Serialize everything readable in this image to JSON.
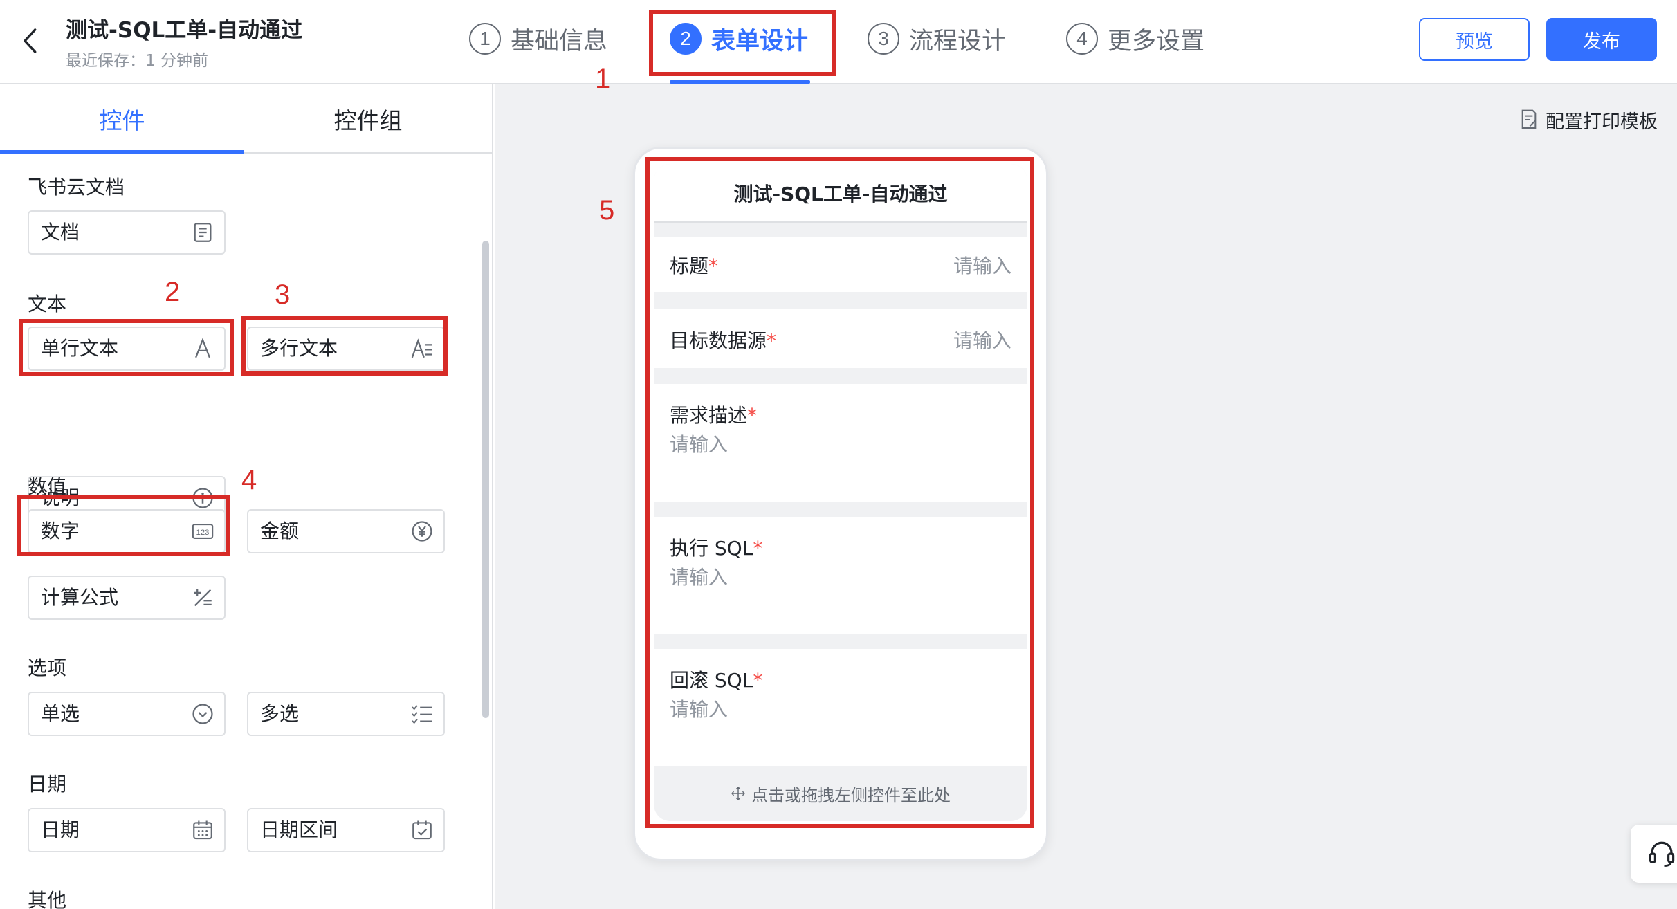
{
  "header": {
    "title": "测试-SQL工单-自动通过",
    "saved": "最近保存：1 分钟前",
    "steps": [
      {
        "num": "1",
        "label": "基础信息"
      },
      {
        "num": "2",
        "label": "表单设计"
      },
      {
        "num": "3",
        "label": "流程设计"
      },
      {
        "num": "4",
        "label": "更多设置"
      }
    ],
    "preview_label": "预览",
    "publish_label": "发布"
  },
  "panel": {
    "tabs": [
      "控件",
      "控件组"
    ],
    "sections": [
      {
        "title": "飞书云文档",
        "controls": [
          {
            "label": "文档",
            "icon": "document-icon"
          }
        ]
      },
      {
        "title": "文本",
        "controls": [
          {
            "label": "单行文本",
            "icon": "single-line-text-icon"
          },
          {
            "label": "多行文本",
            "icon": "multi-line-text-icon"
          },
          {
            "label": "说明",
            "icon": "info-icon"
          }
        ]
      },
      {
        "title": "数值",
        "controls": [
          {
            "label": "数字",
            "icon": "number-123-icon"
          },
          {
            "label": "金额",
            "icon": "yen-coin-icon"
          },
          {
            "label": "计算公式",
            "icon": "formula-icon"
          }
        ]
      },
      {
        "title": "选项",
        "controls": [
          {
            "label": "单选",
            "icon": "chevron-circle-icon"
          },
          {
            "label": "多选",
            "icon": "checklist-icon"
          }
        ]
      },
      {
        "title": "日期",
        "controls": [
          {
            "label": "日期",
            "icon": "calendar-icon"
          },
          {
            "label": "日期区间",
            "icon": "calendar-check-icon"
          }
        ]
      },
      {
        "title": "其他",
        "controls": []
      }
    ]
  },
  "canvas": {
    "print_template": "配置打印模板",
    "form_title": "测试-SQL工单-自动通过",
    "fields": [
      {
        "label": "标题",
        "required": "*",
        "placeholder": "请输入"
      },
      {
        "label": "目标数据源",
        "required": "*",
        "placeholder": "请输入"
      },
      {
        "label": "需求描述",
        "required": "*",
        "placeholder": "请输入"
      },
      {
        "label": "执行 SQL",
        "required": "*",
        "placeholder": "请输入"
      },
      {
        "label": "回滚 SQL",
        "required": "*",
        "placeholder": "请输入"
      }
    ],
    "drop_hint": "点击或拖拽左侧控件至此处"
  },
  "annotations": [
    "1",
    "2",
    "3",
    "4",
    "5"
  ],
  "colors": {
    "accent": "#3370ff",
    "annotation": "#d72b27",
    "required": "#f54a45",
    "canvas_bg": "#f0f1f3"
  }
}
